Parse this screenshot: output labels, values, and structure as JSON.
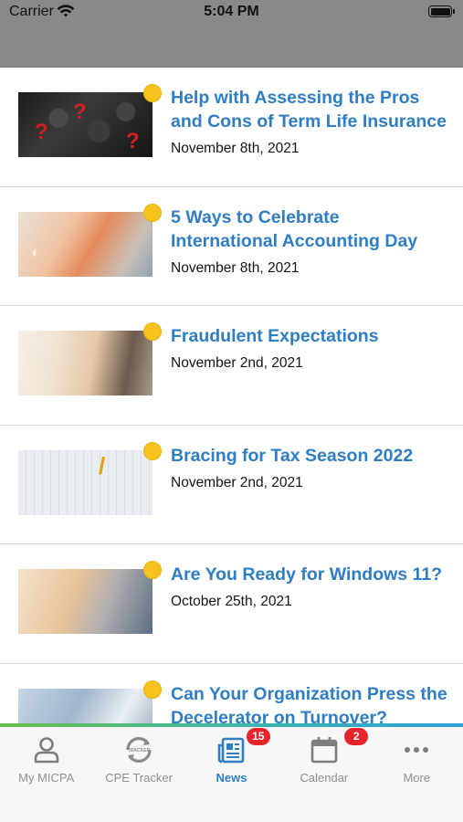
{
  "status_bar": {
    "carrier": "Carrier",
    "time": "5:04 PM",
    "wifi_icon": "wifi-icon",
    "battery_icon": "battery-icon"
  },
  "news": {
    "items": [
      {
        "title": "Help with Assessing the Pros and Cons of Term Life Insurance",
        "date": "November 8th, 2021",
        "image": "question-marks-keyboard-image"
      },
      {
        "title": "5 Ways to Celebrate International Accounting Day",
        "date": "November 8th, 2021",
        "image": "accounting-charts-image"
      },
      {
        "title": "Fraudulent Expectations",
        "date": "November 2nd, 2021",
        "image": "tablet-fraud-image"
      },
      {
        "title": "Bracing for Tax Season 2022",
        "date": "November 2nd, 2021",
        "image": "tax-documents-image"
      },
      {
        "title": "Are You Ready for Windows 11?",
        "date": "October 25th, 2021",
        "image": "laptop-typing-image"
      },
      {
        "title": "Can Your Organization Press the Decelerator on Turnover?",
        "date": "",
        "image": "people-network-image"
      }
    ],
    "unread_color": "#f7c21b",
    "title_color": "#2f7dc3"
  },
  "tab_bar": {
    "tabs": [
      {
        "label": "My MICPA",
        "icon": "person-icon",
        "active": false
      },
      {
        "label": "CPE Tracker",
        "icon": "cpe-tracker-icon",
        "active": false
      },
      {
        "label": "News",
        "icon": "newspaper-icon",
        "active": true,
        "badge": "15"
      },
      {
        "label": "Calendar",
        "icon": "calendar-icon",
        "active": false,
        "badge": "2"
      },
      {
        "label": "More",
        "icon": "more-dots-icon",
        "active": false
      }
    ],
    "active_color": "#2f7dc3",
    "badge_color": "#e8232a"
  }
}
